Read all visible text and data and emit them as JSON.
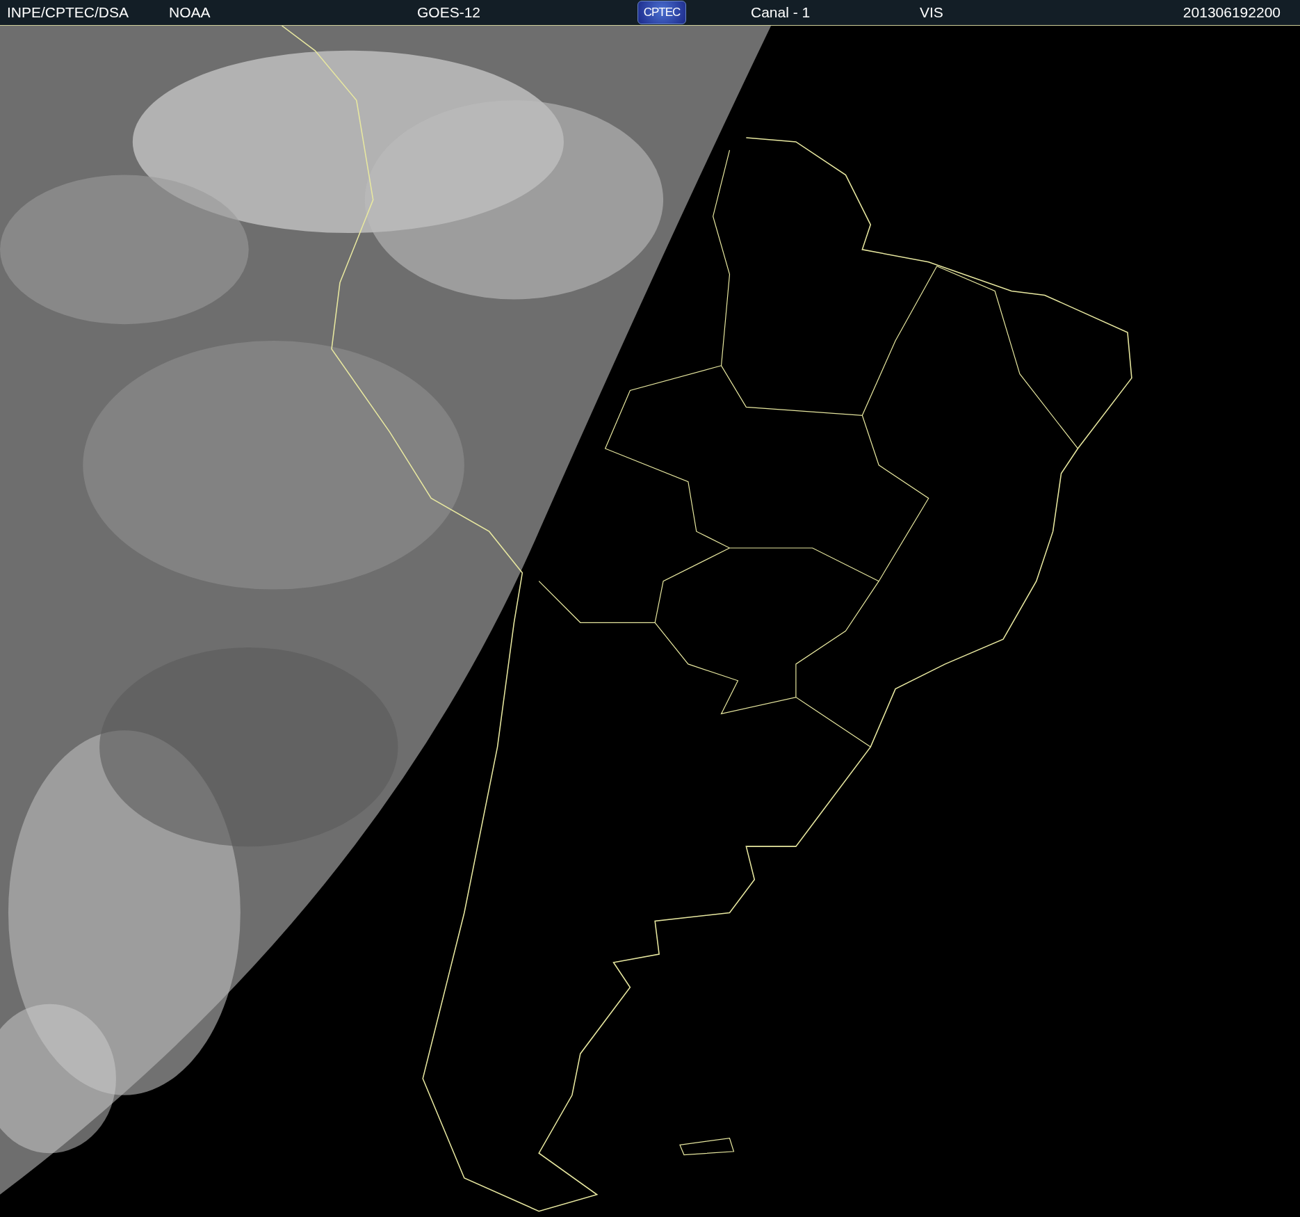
{
  "header": {
    "source": "INPE/CPTEC/DSA",
    "agency": "NOAA",
    "satellite": "GOES-12",
    "logo": "CPTEC",
    "channel": "Canal - 1",
    "band": "VIS",
    "timestamp": "201306192200"
  }
}
